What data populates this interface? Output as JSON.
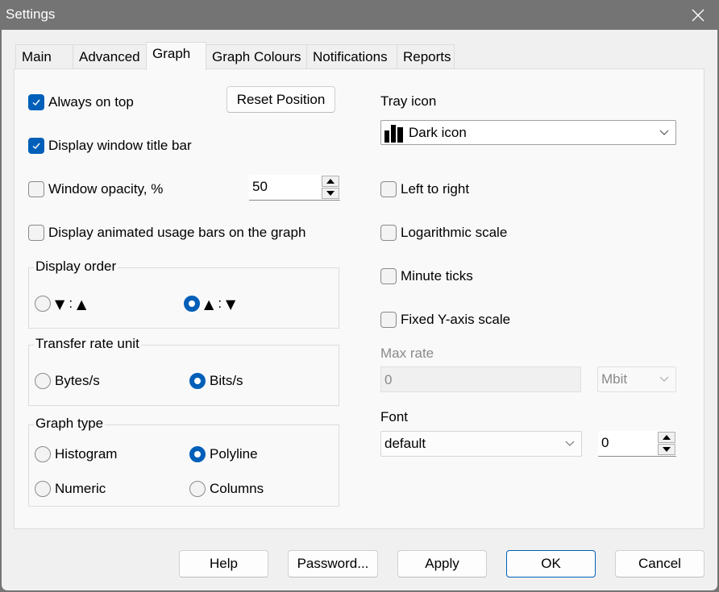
{
  "window": {
    "title": "Settings",
    "close_icon": "close-icon"
  },
  "tabs": [
    {
      "label": "Main",
      "active": false
    },
    {
      "label": "Advanced",
      "active": false
    },
    {
      "label": "Graph",
      "active": true
    },
    {
      "label": "Graph Colours",
      "active": false
    },
    {
      "label": "Notifications",
      "active": false
    },
    {
      "label": "Reports",
      "active": false
    }
  ],
  "graph": {
    "always_on_top": {
      "label": "Always on top",
      "checked": true
    },
    "reset_position_label": "Reset Position",
    "display_title_bar": {
      "label": "Display window title bar",
      "checked": true
    },
    "window_opacity": {
      "label": "Window opacity, %",
      "checked": false,
      "value": "50"
    },
    "animated_bars": {
      "label": "Display animated usage bars on the graph",
      "checked": false
    },
    "display_order": {
      "label": "Display order",
      "options": [
        {
          "left": "▼",
          "sep": ":",
          "right": "▲",
          "selected": false
        },
        {
          "left": "▲",
          "sep": ":",
          "right": "▼",
          "selected": true
        }
      ]
    },
    "transfer_rate_unit": {
      "label": "Transfer rate unit",
      "options": [
        {
          "label": "Bytes/s",
          "selected": false
        },
        {
          "label": "Bits/s",
          "selected": true
        }
      ]
    },
    "graph_type": {
      "label": "Graph type",
      "options": [
        {
          "label": "Histogram",
          "selected": false
        },
        {
          "label": "Polyline",
          "selected": true
        },
        {
          "label": "Numeric",
          "selected": false
        },
        {
          "label": "Columns",
          "selected": false
        }
      ]
    },
    "tray_icon": {
      "label": "Tray icon",
      "value": "Dark icon",
      "icon": "bar-chart-icon"
    },
    "left_to_right": {
      "label": "Left to right",
      "checked": false
    },
    "logarithmic_scale": {
      "label": "Logarithmic scale",
      "checked": false
    },
    "minute_ticks": {
      "label": "Minute ticks",
      "checked": false
    },
    "fixed_y_axis": {
      "label": "Fixed Y-axis scale",
      "checked": false
    },
    "max_rate": {
      "label": "Max rate",
      "value": "0",
      "unit": "Mbit",
      "disabled": true
    },
    "font": {
      "label": "Font",
      "value": "default",
      "size": "0"
    }
  },
  "footer": {
    "help": "Help",
    "password": "Password...",
    "apply": "Apply",
    "ok": "OK",
    "cancel": "Cancel"
  },
  "colors": {
    "accent": "#005fb8",
    "titlebar": "#747474",
    "panel": "#f9f9f9",
    "client": "#f0f0f0"
  }
}
